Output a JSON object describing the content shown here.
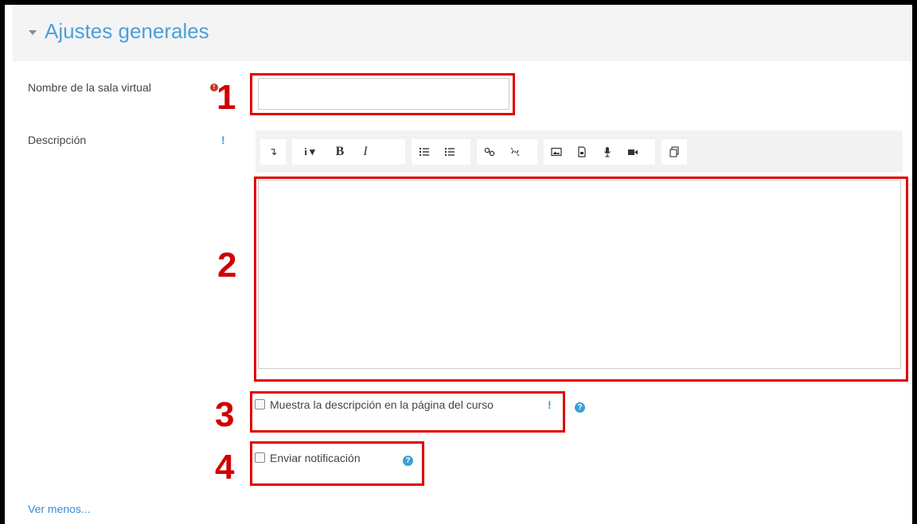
{
  "section": {
    "title": "Ajustes generales"
  },
  "fields": {
    "name_label": "Nombre de la sala virtual",
    "name_value": "",
    "desc_label": "Descripción",
    "required_mark": "!",
    "info_mark": "!"
  },
  "toolbar": {
    "items": [
      "arrow-icon",
      "info-dropdown",
      "bold",
      "italic",
      "unordered-list",
      "ordered-list",
      "link",
      "unlink",
      "image",
      "media",
      "audio",
      "video",
      "manage-files"
    ],
    "bold_label": "B",
    "italic_label": "I",
    "info_label": "i"
  },
  "checkboxes": {
    "show_desc_label": "Muestra la descripción en la página del curso",
    "notify_label": "Enviar notificación"
  },
  "annotations": [
    "1",
    "2",
    "3",
    "4"
  ],
  "footer": {
    "link": "Ver menos..."
  },
  "colors": {
    "accent": "#4aa0dc",
    "annotation": "#e00000",
    "help": "#3a9fd6"
  }
}
